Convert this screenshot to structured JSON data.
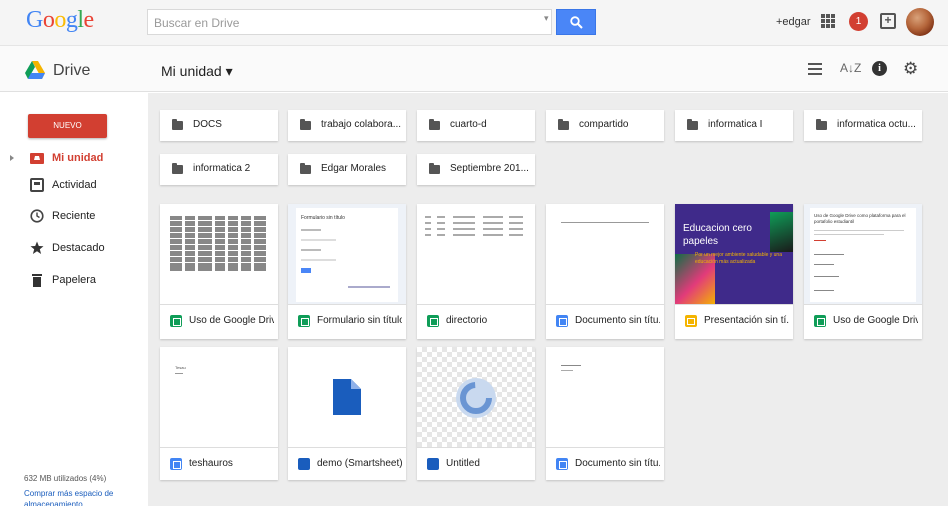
{
  "header": {
    "logo": "Google",
    "search_placeholder": "Buscar en Drive",
    "user": "+edgar",
    "notification_count": "1",
    "colors": {
      "search_button": "#4a86f7",
      "notification": "#d23f31"
    }
  },
  "subbar": {
    "app_name": "Drive",
    "location": "Mi unidad ▾",
    "icons": [
      "list-view-icon",
      "sort-icon",
      "info-icon",
      "settings-gear-icon"
    ]
  },
  "sidebar": {
    "new_button": "NUEVO",
    "items": [
      {
        "label": "Mi unidad",
        "icon": "my-drive-icon",
        "active": true
      },
      {
        "label": "Actividad",
        "icon": "activity-icon",
        "active": false
      },
      {
        "label": "Reciente",
        "icon": "clock-icon",
        "active": false
      },
      {
        "label": "Destacado",
        "icon": "star-icon",
        "active": false
      },
      {
        "label": "Papelera",
        "icon": "trash-icon",
        "active": false
      }
    ],
    "storage_used": "632 MB utilizados (4%)",
    "buy_storage": "Comprar más espacio de almacenamiento"
  },
  "folders": [
    {
      "name": "DOCS",
      "shared": true
    },
    {
      "name": "trabajo colabora...",
      "shared": true
    },
    {
      "name": "cuarto-d",
      "shared": true
    },
    {
      "name": "compartido",
      "shared": true
    },
    {
      "name": "informatica I",
      "shared": false
    },
    {
      "name": "informatica octu...",
      "shared": false
    },
    {
      "name": "informatica 2",
      "shared": false
    },
    {
      "name": "Edgar Morales",
      "shared": false
    },
    {
      "name": "Septiembre 201...",
      "shared": false
    }
  ],
  "files": [
    {
      "name": "Uso de Google Driv...",
      "type": "sheet"
    },
    {
      "name": "Formulario sin título",
      "type": "form",
      "thumb_title": "Formulario sin título"
    },
    {
      "name": "directorio",
      "type": "sheet"
    },
    {
      "name": "Documento sin títu...",
      "type": "doc"
    },
    {
      "name": "Presentación sin tí...",
      "type": "slides",
      "thumb_title": "Educacion cero papeles",
      "thumb_sub": "Por un mejor ambiente saludable y una educación más actualizada"
    },
    {
      "name": "Uso de Google Driv...",
      "type": "form",
      "thumb_title": "Uso de Google Drive como plataforma para el portafolio estudiantil"
    },
    {
      "name": "teshauros",
      "type": "doc",
      "thumb_title": "Tesau"
    },
    {
      "name": "demo (Smartsheet)",
      "type": "file"
    },
    {
      "name": "Untitled",
      "type": "file"
    },
    {
      "name": "Documento sin títu...",
      "type": "doc"
    }
  ]
}
